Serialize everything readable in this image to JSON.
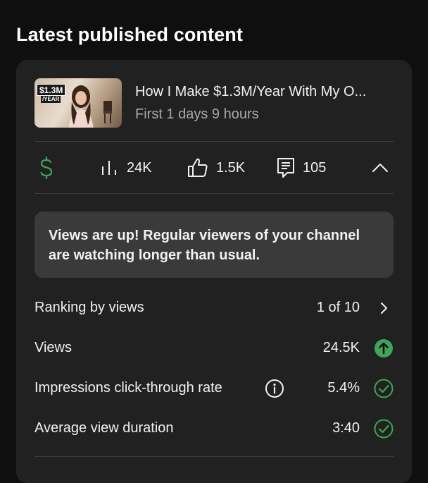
{
  "page": {
    "section_title": "Latest published content"
  },
  "video": {
    "title": "How I Make $1.3M/Year With My O...",
    "subtitle": "First 1 days 9 hours",
    "thumbnail_badge": "$1.3M",
    "thumbnail_badge_sub": "/YEAR"
  },
  "stats": {
    "revenue_icon": "dollar-icon",
    "views": "24K",
    "views_icon": "bar-chart-icon",
    "likes": "1.5K",
    "likes_icon": "thumbs-up-icon",
    "comments": "105",
    "comments_icon": "comment-icon",
    "collapse_icon": "chevron-up-icon"
  },
  "notice": {
    "text": "Views are up! Regular viewers of your channel are watching longer than usual."
  },
  "metrics": [
    {
      "label": "Ranking by views",
      "value": "1 of 10",
      "icon": "chevron-right-icon"
    },
    {
      "label": "Views",
      "value": "24.5K",
      "icon": "arrow-up-circle-icon"
    },
    {
      "label": "Impressions click-through rate",
      "value": "5.4%",
      "icon": "check-circle-icon",
      "info_icon": "info-icon"
    },
    {
      "label": "Average view duration",
      "value": "3:40",
      "icon": "check-circle-icon"
    }
  ],
  "colors": {
    "background": "#0f0f0f",
    "card": "#212121",
    "notice": "#3a3a3a",
    "accent_green": "#3ea55a",
    "muted_text": "#aaaaaa"
  }
}
